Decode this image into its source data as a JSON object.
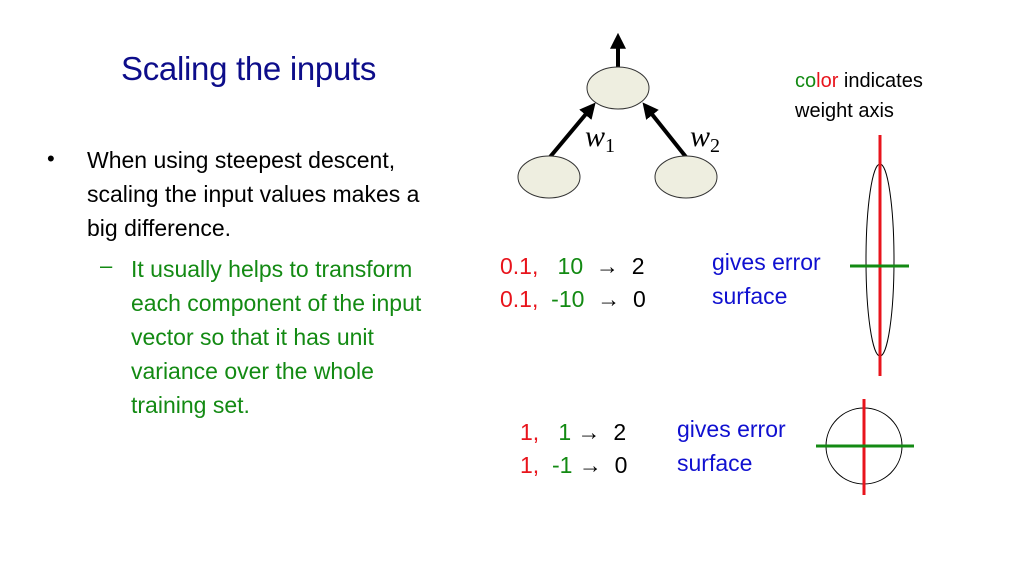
{
  "slide": {
    "title": "Scaling the inputs",
    "bullet": {
      "marker": "•",
      "text": "When using steepest descent, scaling  the input values makes a big difference."
    },
    "sub_bullet": {
      "marker": "–",
      "text": "It usually helps to transform each component of the input vector so that it has unit variance over the whole training set."
    }
  },
  "network_diagram": {
    "weight_labels": [
      {
        "symbol": "w",
        "subscript": "1"
      },
      {
        "symbol": "w",
        "subscript": "2"
      }
    ]
  },
  "legend": {
    "color_word_part1": "co",
    "color_word_part2": "lor",
    "rest_line1": " indicates",
    "line2": "weight axis"
  },
  "examples": [
    {
      "cases": [
        {
          "x1": "0.1,",
          "x2": "10",
          "arrow": "→",
          "target": "2"
        },
        {
          "x1": "0.1,",
          "x2": "-10",
          "arrow": "→",
          "target": "0"
        }
      ],
      "label_line1": "gives error",
      "label_line2": "surface",
      "surface_shape": "elongated-ellipse"
    },
    {
      "cases": [
        {
          "x1": "1,",
          "x2": "1",
          "arrow": "→",
          "target": "2"
        },
        {
          "x1": "1,",
          "x2": "-1",
          "arrow": "→",
          "target": "0"
        }
      ],
      "label_line1": "gives error",
      "label_line2": "surface",
      "surface_shape": "circle"
    }
  ],
  "colors": {
    "title": "#0d0d8a",
    "w1_axis": "#e8141c",
    "w2_axis": "#138a13",
    "label_blue": "#1010d0",
    "node_fill": "#eeeee0"
  }
}
